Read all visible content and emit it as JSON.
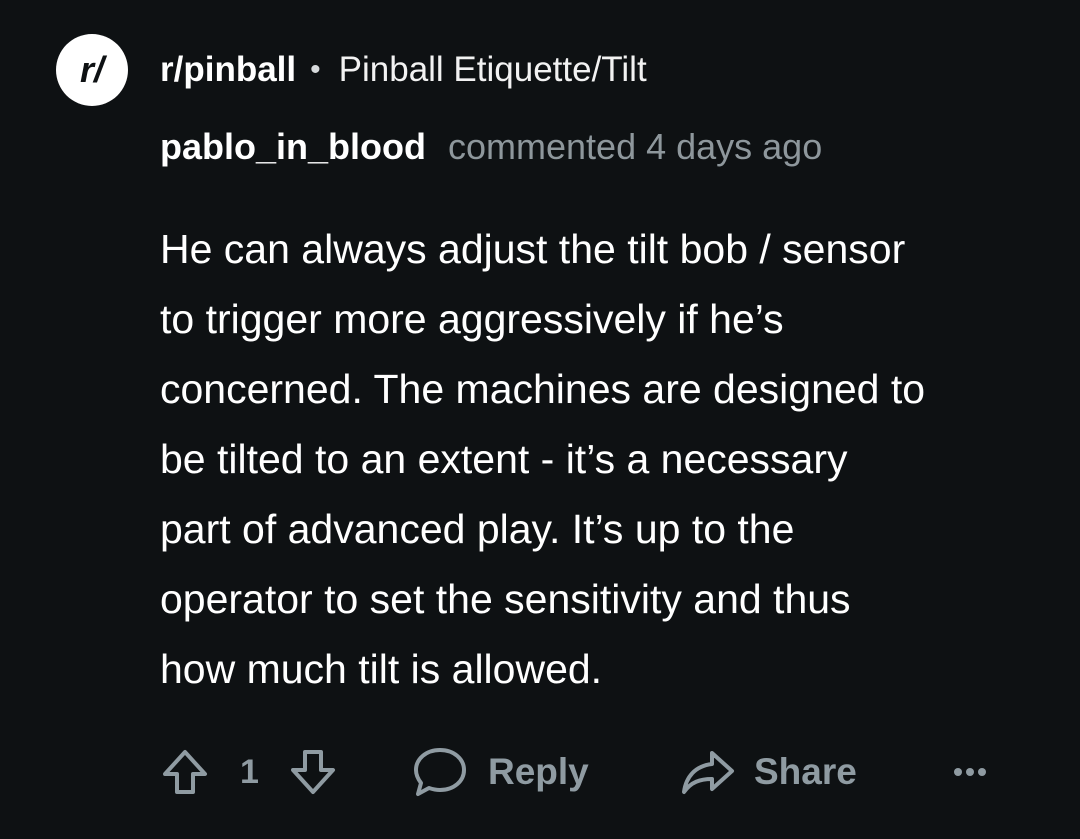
{
  "header": {
    "subreddit_avatar_text": "r/",
    "subreddit_name": "r/pinball",
    "separator": "•",
    "post_title": "Pinball Etiquette/Tilt"
  },
  "comment": {
    "author": "pablo_in_blood",
    "meta": "commented 4 days ago",
    "lines": [
      "He can always adjust the tilt bob / sensor",
      "to trigger more aggressively if he’s",
      "concerned. The machines are designed to",
      "be tilted to an extent - it’s a necessary",
      "part of advanced play. It’s up to the",
      "operator to set the sensitivity and thus",
      "how much tilt is allowed."
    ]
  },
  "actions": {
    "vote_count": "1",
    "reply_label": "Reply",
    "share_label": "Share"
  },
  "icons": {
    "upvote": "arrow-up-outline-icon",
    "downvote": "arrow-down-outline-icon",
    "reply": "speech-bubble-icon",
    "share": "share-arrow-icon",
    "more": "ellipsis-icon"
  },
  "colors": {
    "background": "#0e1113",
    "text_primary": "#ffffff",
    "text_secondary": "#8e979c",
    "action_gray": "#8f9ba2"
  }
}
